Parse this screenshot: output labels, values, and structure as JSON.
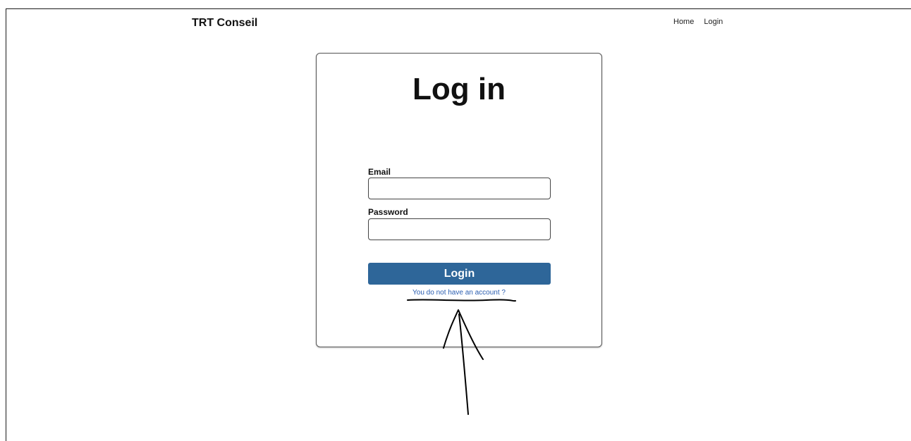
{
  "navbar": {
    "brand": "TRT Conseil",
    "links": [
      "Home",
      "Login"
    ]
  },
  "login_card": {
    "title": "Log in",
    "email_label": "Email",
    "email_value": "",
    "password_label": "Password",
    "password_value": "",
    "submit_label": "Login",
    "signup_link": "You do not have an account ?"
  },
  "colors": {
    "button_bg": "#2e6699",
    "link_text": "#2a5db0",
    "annotation_ink": "#000000"
  }
}
